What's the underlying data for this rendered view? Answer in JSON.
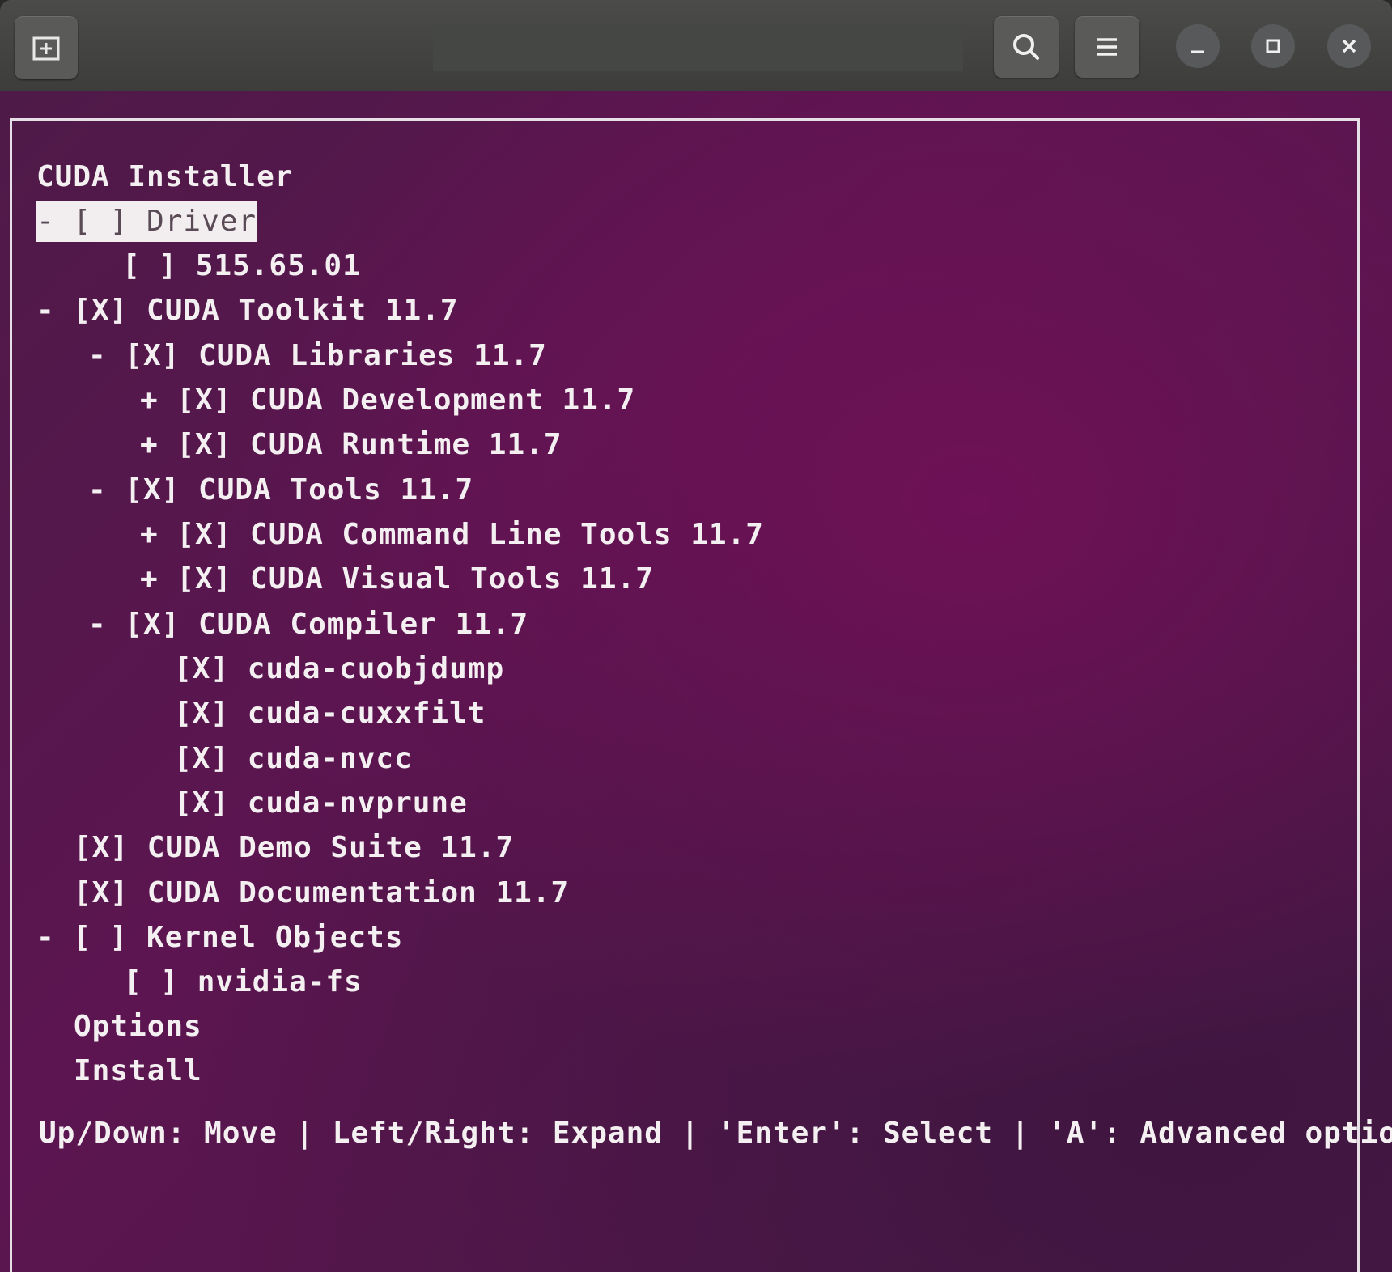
{
  "window": {
    "title": "",
    "buttons": {
      "new_tab_icon": "new-tab-icon",
      "search_icon": "search-icon",
      "menu_icon": "hamburger-menu-icon",
      "minimize_icon": "minimize-icon",
      "maximize_icon": "maximize-icon",
      "close_icon": "close-icon"
    }
  },
  "installer": {
    "title": "CUDA Installer",
    "items": [
      {
        "text": "- [ ] Driver",
        "selected": true
      },
      {
        "text": "[ ] 515.65.01"
      },
      {
        "text": "- [X] CUDA Toolkit 11.7"
      },
      {
        "text": "- [X] CUDA Libraries 11.7"
      },
      {
        "text": "+ [X] CUDA Development 11.7"
      },
      {
        "text": "+ [X] CUDA Runtime 11.7"
      },
      {
        "text": "- [X] CUDA Tools 11.7"
      },
      {
        "text": "+ [X] CUDA Command Line Tools 11.7"
      },
      {
        "text": "+ [X] CUDA Visual Tools 11.7"
      },
      {
        "text": "- [X] CUDA Compiler 11.7"
      },
      {
        "text": "[X] cuda-cuobjdump"
      },
      {
        "text": "[X] cuda-cuxxfilt"
      },
      {
        "text": "[X] cuda-nvcc"
      },
      {
        "text": "[X] cuda-nvprune"
      },
      {
        "text": "[X] CUDA Demo Suite 11.7"
      },
      {
        "text": "[X] CUDA Documentation 11.7"
      },
      {
        "text": "- [ ] Kernel Objects"
      },
      {
        "text": "[ ] nvidia-fs"
      },
      {
        "text": "Options"
      },
      {
        "text": "Install"
      }
    ],
    "footer": "Up/Down: Move | Left/Right: Expand | 'Enter': Select | 'A': Advanced options"
  },
  "colors": {
    "terminal_bg": "#5c1550",
    "text": "#f4f0f2",
    "selection_bg": "#f2eef0",
    "titlebar": "#3d3d3b"
  }
}
